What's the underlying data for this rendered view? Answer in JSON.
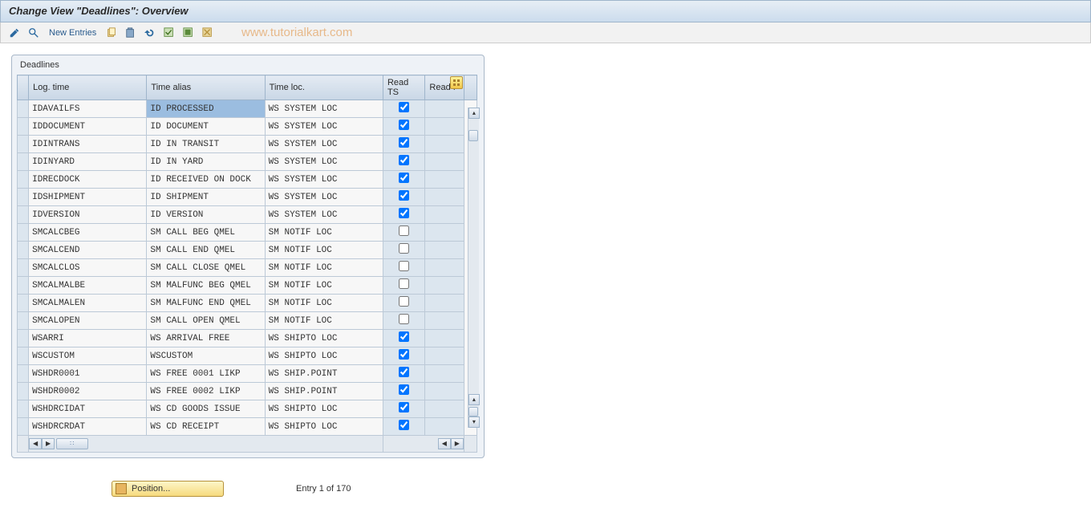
{
  "titlebar": {
    "text": "Change View \"Deadlines\": Overview"
  },
  "toolbar": {
    "new_entries_label": "New Entries",
    "watermark": "www.tutorialkart.com"
  },
  "groupbox": {
    "title": "Deadlines"
  },
  "columns": {
    "log_time": "Log. time",
    "time_alias": "Time alias",
    "time_loc": "Time loc.",
    "read_ts": "Read TS",
    "read_i": "Read I"
  },
  "rows": [
    {
      "log_time": "IDAVAILFS",
      "time_alias": "ID PROCESSED",
      "time_loc": "WS SYSTEM LOC",
      "read_ts": true,
      "selected_alias": true
    },
    {
      "log_time": "IDDOCUMENT",
      "time_alias": "ID DOCUMENT",
      "time_loc": "WS SYSTEM LOC",
      "read_ts": true
    },
    {
      "log_time": "IDINTRANS",
      "time_alias": "ID IN TRANSIT",
      "time_loc": "WS SYSTEM LOC",
      "read_ts": true
    },
    {
      "log_time": "IDINYARD",
      "time_alias": "ID IN YARD",
      "time_loc": "WS SYSTEM LOC",
      "read_ts": true
    },
    {
      "log_time": "IDRECDOCK",
      "time_alias": "ID RECEIVED ON DOCK",
      "time_loc": "WS SYSTEM LOC",
      "read_ts": true
    },
    {
      "log_time": "IDSHIPMENT",
      "time_alias": "ID SHIPMENT",
      "time_loc": "WS SYSTEM LOC",
      "read_ts": true
    },
    {
      "log_time": "IDVERSION",
      "time_alias": "ID VERSION",
      "time_loc": "WS SYSTEM LOC",
      "read_ts": true
    },
    {
      "log_time": "SMCALCBEG",
      "time_alias": "SM CALL BEG    QMEL",
      "time_loc": "SM NOTIF  LOC",
      "read_ts": false
    },
    {
      "log_time": "SMCALCEND",
      "time_alias": "SM CALL END    QMEL",
      "time_loc": "SM NOTIF  LOC",
      "read_ts": false
    },
    {
      "log_time": "SMCALCLOS",
      "time_alias": "SM CALL CLOSE  QMEL",
      "time_loc": "SM NOTIF  LOC",
      "read_ts": false
    },
    {
      "log_time": "SMCALMALBE",
      "time_alias": "SM MALFUNC BEG QMEL",
      "time_loc": "SM NOTIF  LOC",
      "read_ts": false
    },
    {
      "log_time": "SMCALMALEN",
      "time_alias": "SM MALFUNC END QMEL",
      "time_loc": "SM NOTIF  LOC",
      "read_ts": false
    },
    {
      "log_time": "SMCALOPEN",
      "time_alias": "SM CALL OPEN   QMEL",
      "time_loc": "SM NOTIF  LOC",
      "read_ts": false
    },
    {
      "log_time": "WSARRI",
      "time_alias": "WS ARRIVAL     FREE",
      "time_loc": "WS SHIPTO LOC",
      "read_ts": true
    },
    {
      "log_time": "WSCUSTOM",
      "time_alias": "WSCUSTOM",
      "time_loc": "WS SHIPTO LOC",
      "read_ts": true
    },
    {
      "log_time": "WSHDR0001",
      "time_alias": "WS FREE 0001   LIKP",
      "time_loc": "WS SHIP.POINT",
      "read_ts": true
    },
    {
      "log_time": "WSHDR0002",
      "time_alias": "WS FREE 0002   LIKP",
      "time_loc": "WS SHIP.POINT",
      "read_ts": true
    },
    {
      "log_time": "WSHDRCIDAT",
      "time_alias": "WS CD GOODS ISSUE",
      "time_loc": "WS SHIPTO LOC",
      "read_ts": true
    },
    {
      "log_time": "WSHDRCRDAT",
      "time_alias": "WS CD RECEIPT",
      "time_loc": "WS SHIPTO LOC",
      "read_ts": true
    }
  ],
  "status": {
    "position_label": "Position...",
    "entry_text": "Entry 1 of 170"
  }
}
